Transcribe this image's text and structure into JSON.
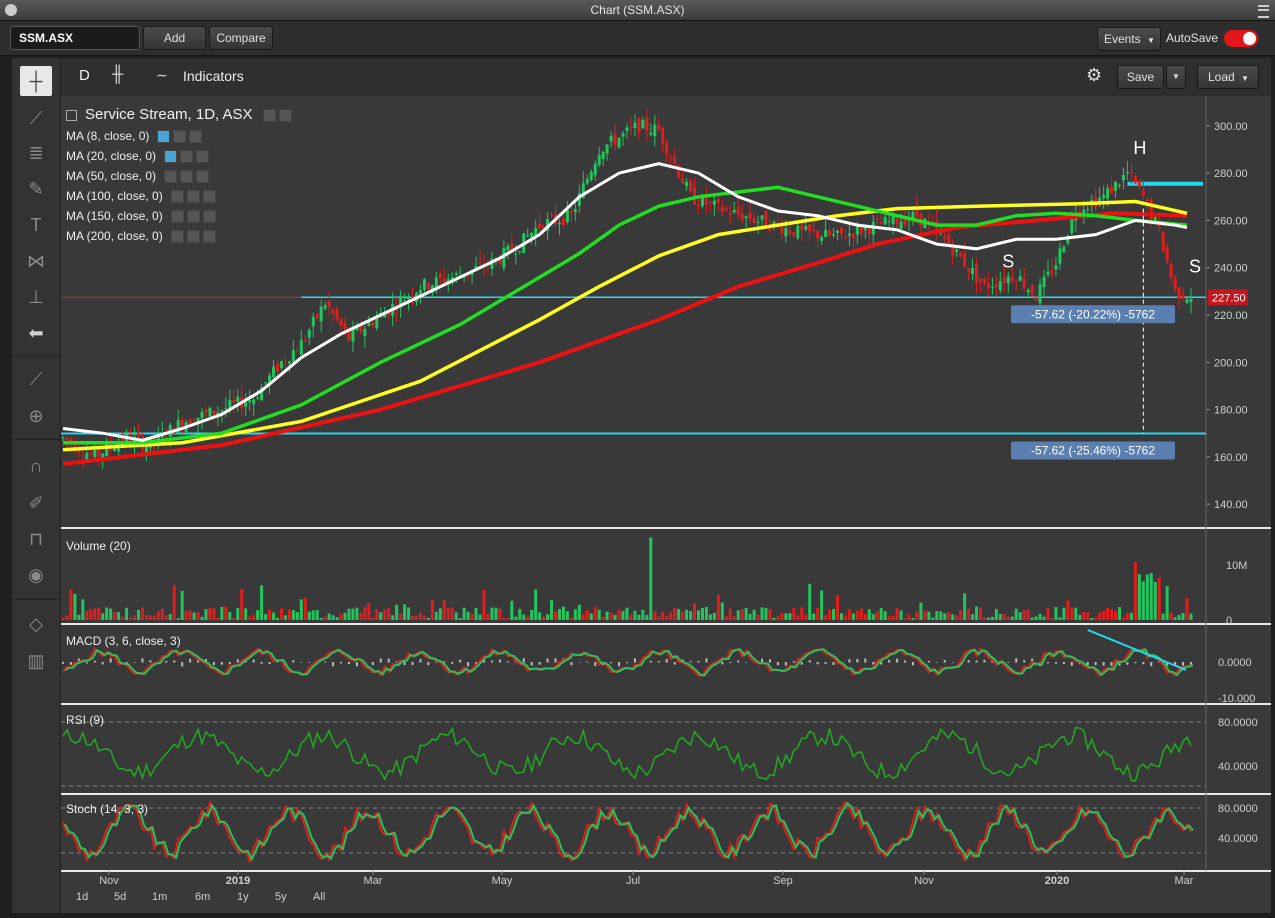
{
  "window": {
    "title": "Chart (SSM.ASX)"
  },
  "toolbar": {
    "symbol": "SSM.ASX",
    "add_label": "Add",
    "compare_label": "Compare",
    "events_label": "Events",
    "autosave_label": "AutoSave",
    "autosave_on": true
  },
  "chart_header": {
    "period": "D",
    "indicators_label": "Indicators",
    "save_label": "Save",
    "load_label": "Load"
  },
  "colors": {
    "bg": "#393939",
    "up": "#22c55e",
    "down": "#e11d1d",
    "ma8": "#ffffff",
    "ma20": "#22dd22",
    "ma50": "#ffff22",
    "ma100": "#ee1111",
    "hline": "#26d7f0",
    "label_box": "#5a7fb0"
  },
  "legend": {
    "title": "Service Stream, 1D, ASX",
    "items": [
      "MA (8, close, 0)",
      "MA (20, close, 0)",
      "MA (50, close, 0)",
      "MA (100, close, 0)",
      "MA (150, close, 0)",
      "MA (200, close, 0)"
    ]
  },
  "panels": {
    "volume": "Volume (20)",
    "macd": "MACD (3, 6, close, 3)",
    "rsi": "RSI (9)",
    "stoch": "Stoch (14, 3, 3)"
  },
  "range_buttons": [
    "1d",
    "5d",
    "1m",
    "6m",
    "1y",
    "5y",
    "All"
  ],
  "annotations": {
    "h": "H",
    "s1": "S",
    "s2": "S",
    "box1": "-57.62 (-20.22%) -5762",
    "box2": "-57.62 (-25.46%) -5762",
    "price_tag": "227.50"
  },
  "chart_data": {
    "type": "candlestick",
    "title": "Service Stream, 1D, ASX",
    "x_ticks": [
      "Nov",
      "2019",
      "Mar",
      "May",
      "Jul",
      "Sep",
      "Nov",
      "2020",
      "Mar"
    ],
    "y_ticks": [
      "140.00",
      "160.00",
      "180.00",
      "200.00",
      "220.00",
      "240.00",
      "260.00",
      "280.00",
      "300.00"
    ],
    "ylim": [
      135,
      305
    ],
    "current_price": 227.5,
    "levels": [
      {
        "name": "support",
        "value": 227.5
      },
      {
        "name": "target",
        "value": 169.9
      },
      {
        "name": "resistance",
        "value": 275.5
      }
    ],
    "price_path": [
      [
        0,
        168
      ],
      [
        8,
        160
      ],
      [
        15,
        168
      ],
      [
        22,
        165
      ],
      [
        30,
        175
      ],
      [
        40,
        180
      ],
      [
        48,
        185
      ],
      [
        55,
        200
      ],
      [
        60,
        208
      ],
      [
        66,
        225
      ],
      [
        72,
        210
      ],
      [
        80,
        220
      ],
      [
        90,
        232
      ],
      [
        100,
        237
      ],
      [
        108,
        242
      ],
      [
        115,
        250
      ],
      [
        120,
        258
      ],
      [
        128,
        262
      ],
      [
        135,
        290
      ],
      [
        145,
        300
      ],
      [
        150,
        298
      ],
      [
        158,
        270
      ],
      [
        165,
        265
      ],
      [
        175,
        260
      ],
      [
        185,
        255
      ],
      [
        195,
        253
      ],
      [
        205,
        258
      ],
      [
        215,
        262
      ],
      [
        222,
        252
      ],
      [
        228,
        240
      ],
      [
        232,
        232
      ],
      [
        236,
        235
      ],
      [
        240,
        237
      ],
      [
        245,
        228
      ],
      [
        250,
        242
      ],
      [
        255,
        265
      ],
      [
        262,
        270
      ],
      [
        268,
        280
      ],
      [
        272,
        270
      ],
      [
        276,
        255
      ],
      [
        280,
        230
      ],
      [
        284,
        228
      ]
    ],
    "ma8": [
      [
        0,
        172
      ],
      [
        10,
        170
      ],
      [
        20,
        167
      ],
      [
        30,
        172
      ],
      [
        40,
        178
      ],
      [
        50,
        188
      ],
      [
        60,
        202
      ],
      [
        70,
        212
      ],
      [
        80,
        220
      ],
      [
        90,
        228
      ],
      [
        100,
        236
      ],
      [
        110,
        244
      ],
      [
        120,
        254
      ],
      [
        130,
        270
      ],
      [
        140,
        280
      ],
      [
        150,
        284
      ],
      [
        160,
        280
      ],
      [
        170,
        270
      ],
      [
        180,
        264
      ],
      [
        190,
        262
      ],
      [
        200,
        258
      ],
      [
        210,
        256
      ],
      [
        220,
        250
      ],
      [
        230,
        248
      ],
      [
        240,
        252
      ],
      [
        250,
        252
      ],
      [
        260,
        254
      ],
      [
        270,
        260
      ],
      [
        280,
        258
      ],
      [
        283,
        257
      ]
    ],
    "ma20": [
      [
        0,
        166
      ],
      [
        20,
        166
      ],
      [
        40,
        170
      ],
      [
        60,
        182
      ],
      [
        80,
        200
      ],
      [
        100,
        216
      ],
      [
        120,
        236
      ],
      [
        130,
        246
      ],
      [
        140,
        258
      ],
      [
        150,
        266
      ],
      [
        160,
        270
      ],
      [
        170,
        272
      ],
      [
        180,
        274
      ],
      [
        190,
        270
      ],
      [
        200,
        266
      ],
      [
        210,
        262
      ],
      [
        220,
        258
      ],
      [
        230,
        258
      ],
      [
        240,
        262
      ],
      [
        250,
        263
      ],
      [
        260,
        262
      ],
      [
        270,
        260
      ],
      [
        283,
        258
      ]
    ],
    "ma50": [
      [
        0,
        163
      ],
      [
        30,
        166
      ],
      [
        60,
        175
      ],
      [
        90,
        192
      ],
      [
        120,
        218
      ],
      [
        135,
        232
      ],
      [
        150,
        245
      ],
      [
        165,
        254
      ],
      [
        180,
        258
      ],
      [
        195,
        262
      ],
      [
        210,
        265
      ],
      [
        230,
        266
      ],
      [
        255,
        267
      ],
      [
        270,
        268
      ],
      [
        283,
        263
      ]
    ],
    "ma100": [
      [
        0,
        157
      ],
      [
        40,
        165
      ],
      [
        80,
        180
      ],
      [
        120,
        200
      ],
      [
        150,
        218
      ],
      [
        170,
        232
      ],
      [
        190,
        242
      ],
      [
        205,
        250
      ],
      [
        225,
        257
      ],
      [
        245,
        260
      ],
      [
        265,
        263
      ],
      [
        283,
        262
      ]
    ],
    "x_range": [
      0,
      284
    ],
    "volume_ylim": [
      0,
      16
    ],
    "volume_ticks": [
      "10M",
      "0"
    ],
    "macd_ticks": [
      "0.0000",
      "-10.000"
    ],
    "rsi_ticks": [
      "80.0000",
      "40.0000"
    ],
    "stoch_ticks": [
      "80.0000",
      "40.0000"
    ]
  }
}
